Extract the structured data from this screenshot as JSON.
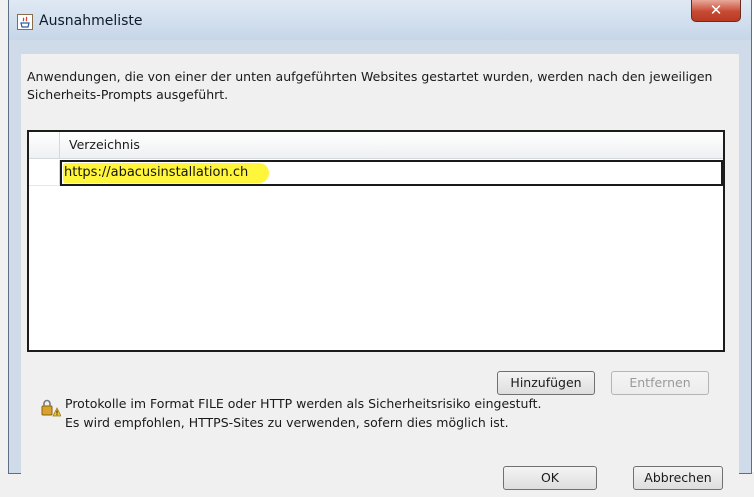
{
  "window": {
    "title": "Ausnahmeliste",
    "close_label": "✕"
  },
  "description": "Anwendungen, die von einer der unten aufgeführten Websites gestartet wurden, werden nach den jeweiligen Sicherheits-Prompts ausgeführt.",
  "table": {
    "column_header": "Verzeichnis",
    "rows": [
      {
        "value": "https://abacusinstallation.ch",
        "highlighted": true,
        "highlight_color": "#fff53a"
      }
    ]
  },
  "buttons": {
    "add": "Hinzufügen",
    "remove": "Entfernen",
    "ok": "OK",
    "cancel": "Abbrechen"
  },
  "warning": {
    "icon": "lock-warning-icon",
    "line1": "Protokolle im Format FILE oder HTTP werden als Sicherheitsrisiko eingestuft.",
    "line2": "Es wird empfohlen, HTTPS-Sites zu verwenden, sofern dies möglich ist."
  },
  "colors": {
    "title_bar": "#c6d6e8",
    "close_button": "#c74a33",
    "client_background": "#f0f0f0"
  }
}
